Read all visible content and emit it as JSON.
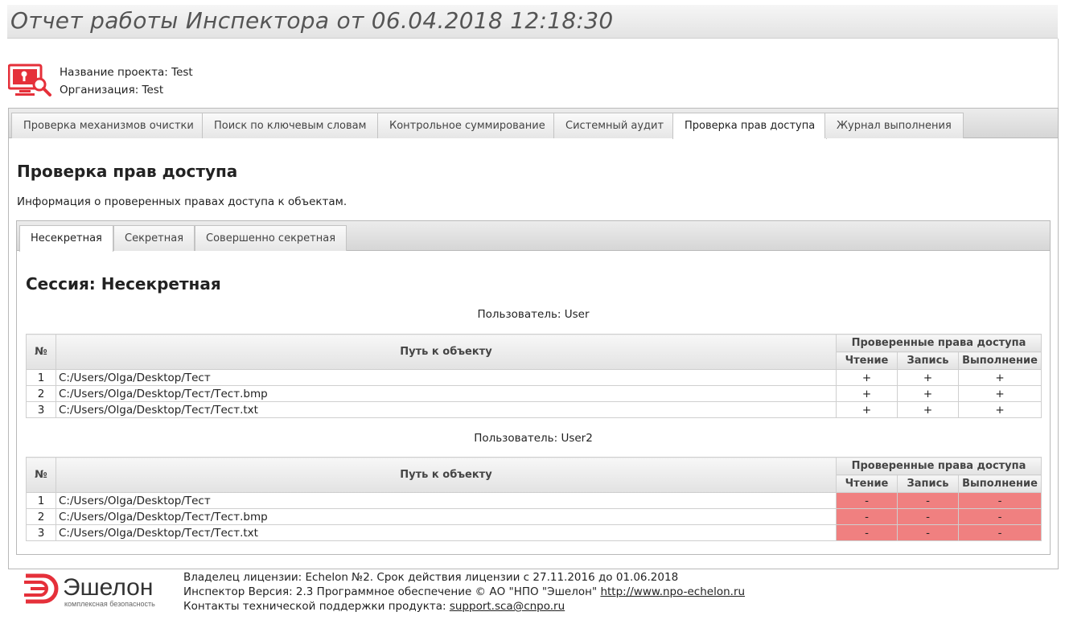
{
  "report": {
    "title": "Отчет работы Инспектора от 06.04.2018 12:18:30"
  },
  "project": {
    "name_line": "Название проекта: Test",
    "org_line": "Организация: Test"
  },
  "tabs": [
    {
      "label": "Проверка механизмов очистки",
      "active": false
    },
    {
      "label": "Поиск по ключевым словам",
      "active": false
    },
    {
      "label": "Контрольное суммирование",
      "active": false
    },
    {
      "label": "Системный аудит",
      "active": false
    },
    {
      "label": "Проверка прав доступа",
      "active": true
    },
    {
      "label": "Журнал выполнения",
      "active": false
    }
  ],
  "panel": {
    "title": "Проверка прав доступа",
    "description": "Информация о проверенных правах доступа к объектам."
  },
  "session_tabs": [
    {
      "label": "Несекретная",
      "active": true
    },
    {
      "label": "Секретная",
      "active": false
    },
    {
      "label": "Совершенно секретная",
      "active": false
    }
  ],
  "session": {
    "title": "Сессия: Несекретная"
  },
  "table_headers": {
    "num": "№",
    "path": "Путь к объекту",
    "rights_group": "Проверенные права доступа",
    "read": "Чтение",
    "write": "Запись",
    "exec": "Выполнение"
  },
  "users": [
    {
      "caption": "Пользователь: User",
      "rows": [
        {
          "num": "1",
          "path": "C:/Users/Olga/Desktop/Тест",
          "read": "+",
          "write": "+",
          "exec": "+",
          "denied": false
        },
        {
          "num": "2",
          "path": "C:/Users/Olga/Desktop/Тест/Тест.bmp",
          "read": "+",
          "write": "+",
          "exec": "+",
          "denied": false
        },
        {
          "num": "3",
          "path": "C:/Users/Olga/Desktop/Тест/Тест.txt",
          "read": "+",
          "write": "+",
          "exec": "+",
          "denied": false
        }
      ]
    },
    {
      "caption": "Пользователь: User2",
      "rows": [
        {
          "num": "1",
          "path": "C:/Users/Olga/Desktop/Тест",
          "read": "-",
          "write": "-",
          "exec": "-",
          "denied": true
        },
        {
          "num": "2",
          "path": "C:/Users/Olga/Desktop/Тест/Тест.bmp",
          "read": "-",
          "write": "-",
          "exec": "-",
          "denied": true
        },
        {
          "num": "3",
          "path": "C:/Users/Olga/Desktop/Тест/Тест.txt",
          "read": "-",
          "write": "-",
          "exec": "-",
          "denied": true
        }
      ]
    }
  ],
  "footer": {
    "logo_name": "Эшелон",
    "logo_tagline": "комплексная безопасность",
    "license_line": "Владелец лицензии: Echelon №2. Срок действия лицензии с 27.11.2016 до 01.06.2018",
    "version_prefix": "Инспектор Версия: 2.3 Программное обеспечение © АО \"НПО \"Эшелон\" ",
    "website": "http://www.npo-echelon.ru",
    "support_prefix": "Контакты технической поддержки продукта: ",
    "support_email": "support.sca@cnpo.ru"
  },
  "colors": {
    "denied": "#f08080",
    "brand_red": "#e5303a"
  },
  "icons": {
    "project_logo": "monitor-lock-search-icon"
  }
}
